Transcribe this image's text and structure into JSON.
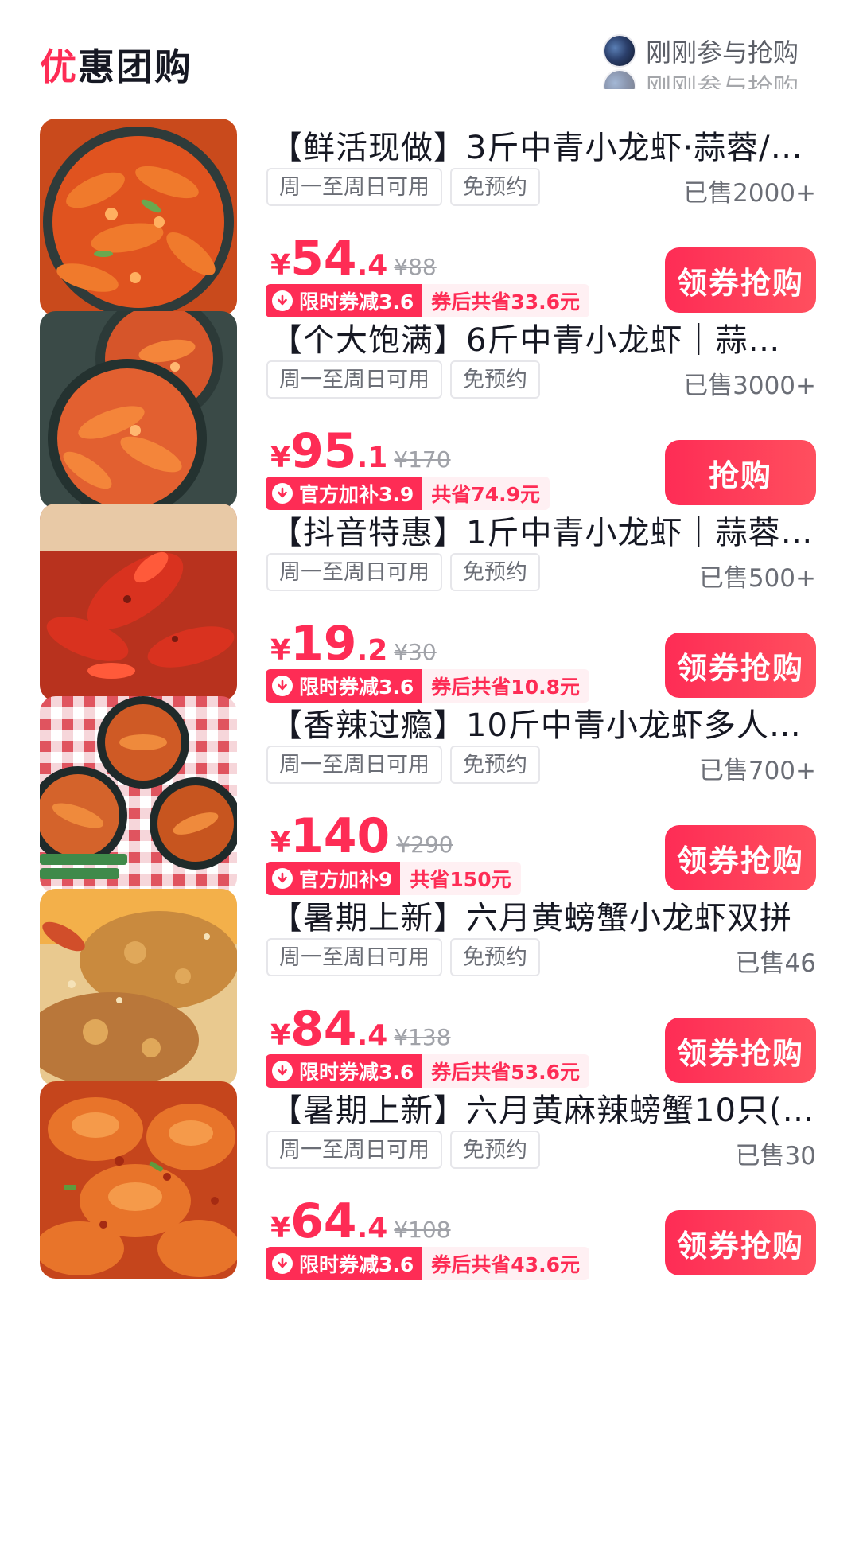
{
  "section": {
    "title_accent": "优",
    "title_rest": "惠团购"
  },
  "ticker": {
    "current": "刚刚参与抢购",
    "next": "刚刚参与抢购"
  },
  "deals": [
    {
      "title": "【鲜活现做】3斤中青小龙虾·蒜蓉/…",
      "tags": [
        "周一至周日可用",
        "免预约"
      ],
      "sold": "已售2000+",
      "yen": "¥",
      "price_int": "54",
      "price_dec": ".4",
      "original": "¥88",
      "promo_label": "限时券减3.6",
      "promo_save": "券后共省33.6元",
      "button": "领券抢购"
    },
    {
      "title": "【个大饱满】6斤中青小龙虾｜蒜…",
      "tags": [
        "周一至周日可用",
        "免预约"
      ],
      "sold": "已售3000+",
      "yen": "¥",
      "price_int": "95",
      "price_dec": ".1",
      "original": "¥170",
      "promo_label": "官方加补3.9",
      "promo_save": "共省74.9元",
      "button": "抢购"
    },
    {
      "title": "【抖音特惠】1斤中青小龙虾｜蒜蓉…",
      "tags": [
        "周一至周日可用",
        "免预约"
      ],
      "sold": "已售500+",
      "yen": "¥",
      "price_int": "19",
      "price_dec": ".2",
      "original": "¥30",
      "promo_label": "限时券减3.6",
      "promo_save": "券后共省10.8元",
      "button": "领券抢购"
    },
    {
      "title": "【香辣过瘾】10斤中青小龙虾多人…",
      "tags": [
        "周一至周日可用",
        "免预约"
      ],
      "sold": "已售700+",
      "yen": "¥",
      "price_int": "140",
      "price_dec": "",
      "original": "¥290",
      "promo_label": "官方加补9",
      "promo_save": "共省150元",
      "button": "领券抢购"
    },
    {
      "title": "【暑期上新】六月黄螃蟹小龙虾双拼",
      "tags": [
        "周一至周日可用",
        "免预约"
      ],
      "sold": "已售46",
      "yen": "¥",
      "price_int": "84",
      "price_dec": ".4",
      "original": "¥138",
      "promo_label": "限时券减3.6",
      "promo_save": "券后共省53.6元",
      "button": "领券抢购"
    },
    {
      "title": "【暑期上新】六月黄麻辣螃蟹10只(…",
      "tags": [
        "周一至周日可用",
        "免预约"
      ],
      "sold": "已售30",
      "yen": "¥",
      "price_int": "64",
      "price_dec": ".4",
      "original": "¥108",
      "promo_label": "限时券减3.6",
      "promo_save": "券后共省43.6元",
      "button": "领券抢购"
    }
  ],
  "colors": {
    "accent": "#fe2c55",
    "promo_bg": "#fff0f3",
    "muted": "#6b6e76"
  }
}
